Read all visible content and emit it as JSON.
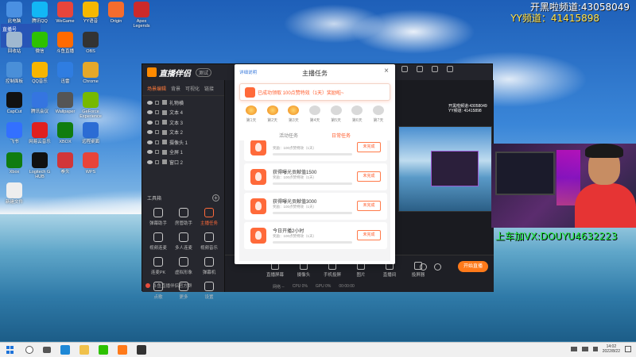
{
  "overlay": {
    "line1": "开黑啦频道:43058049",
    "line2": "YY频道：41415898",
    "line3": "上车加VX:DOUYU4632223"
  },
  "top_left_overlay": "直播号",
  "desktop_icons": [
    {
      "label": "此电脑",
      "color": "#4a90e2"
    },
    {
      "label": "腾讯QQ",
      "color": "#12b7f5"
    },
    {
      "label": "WeGame",
      "color": "#e8453c"
    },
    {
      "label": "YY语音",
      "color": "#f5b800"
    },
    {
      "label": "Origin",
      "color": "#f56c2d"
    },
    {
      "label": "Apex Legends",
      "color": "#cc2a2a"
    },
    {
      "label": "回收站",
      "color": "#9fb8d0"
    },
    {
      "label": "微信",
      "color": "#2dc100"
    },
    {
      "label": "斗鱼直播",
      "color": "#ff6a00"
    },
    {
      "label": "OBS",
      "color": "#333333"
    },
    {
      "label": "Steam",
      "color": "#1b2838"
    },
    {
      "label": "Apex Legends",
      "color": "#b02020"
    },
    {
      "label": "控制面板",
      "color": "#4a8fd8"
    },
    {
      "label": "QQ音乐",
      "color": "#f7b500"
    },
    {
      "label": "迅雷",
      "color": "#2f7de1"
    },
    {
      "label": "Chrome",
      "color": "#e5a82a"
    },
    {
      "label": "BattlEye",
      "color": "#1aa0b0"
    },
    {
      "label": "Microsoft Edge",
      "color": "#1e88d6"
    },
    {
      "label": "CapCut",
      "color": "#111111"
    },
    {
      "label": "腾讯会议",
      "color": "#3575e0"
    },
    {
      "label": "Wallpaper",
      "color": "#555555"
    },
    {
      "label": "GeForce Experience",
      "color": "#76b900"
    },
    {
      "label": "Wallpaper Engine",
      "color": "#2a6cd8"
    },
    {
      "label": "火绒",
      "color": "#ff7a00"
    },
    {
      "label": "飞书",
      "color": "#3370ff"
    },
    {
      "label": "网易云音乐",
      "color": "#e02020"
    },
    {
      "label": "XBOX",
      "color": "#107c10"
    },
    {
      "label": "远程桌面",
      "color": "#2b6cd4"
    },
    {
      "label": "Apex",
      "color": "#222222"
    },
    {
      "label": "雷神",
      "color": "#aaaaaa"
    },
    {
      "label": "Xbox",
      "color": "#107c10"
    },
    {
      "label": "Logitech G HUB",
      "color": "#111111"
    },
    {
      "label": "拳头",
      "color": "#d13639"
    },
    {
      "label": "WPS",
      "color": "#e8443a"
    },
    {
      "label": "文档",
      "color": "#f4f4f4"
    },
    {
      "label": "Golden Axe",
      "color": "#e89a20"
    },
    {
      "label": "新建文件",
      "color": "#eeeeee"
    }
  ],
  "app": {
    "name": "直播伴侣",
    "badge": "测试",
    "left_tabs": [
      "场景编辑",
      "背景",
      "可视化",
      "链接"
    ],
    "scenes": [
      "礼物横",
      "文本 4",
      "文本 3",
      "文本 2",
      "摄像头 1",
      "全屏 1",
      "窗口 2"
    ],
    "tools_title": "工具箱",
    "tools": [
      "弹幕助手",
      "房管助手",
      "主播任务",
      "视频连麦",
      "多人连麦",
      "视频音乐",
      "连麦PK",
      "虚拟形象",
      "弹幕机",
      "点歌",
      "更多",
      "设置"
    ],
    "footer": "斗鱼直播伴侣官方群",
    "bottom_tools": [
      "直播屏幕",
      "摄像头",
      "手机投屏",
      "图片",
      "直播间",
      "投屏器"
    ],
    "bottom_stats": [
      "网络 --",
      "CPU 0%",
      "GPU 0%",
      "00:00:00"
    ],
    "go_live": "开始直播",
    "preview_info": [
      "开黑啦频道:43058049",
      "YY频道: 41415898"
    ]
  },
  "dialog": {
    "link": "详细说明",
    "title": "主播任务",
    "close": "×",
    "banner": "已成功领取 100点赞特效（1天）奖励啦~",
    "days": [
      {
        "label": "第1天",
        "done": true
      },
      {
        "label": "第2天",
        "done": true
      },
      {
        "label": "第3天",
        "done": true
      },
      {
        "label": "第4天",
        "done": false
      },
      {
        "label": "第5天",
        "done": false
      },
      {
        "label": "第6天",
        "done": false
      },
      {
        "label": "第7天",
        "done": false
      }
    ],
    "tabs": [
      "活动任务",
      "日常任务"
    ],
    "active_tab": 1,
    "tasks": [
      {
        "title": "",
        "reward": "奖励：100点赞特效（1天）",
        "button": "未完成"
      },
      {
        "title": "获得曝光贡献值1500",
        "reward": "奖励：100点赞特效（1天）",
        "button": "未完成"
      },
      {
        "title": "获得曝光贡献值3000",
        "reward": "奖励：100点赞特效（1天）",
        "button": "未完成"
      },
      {
        "title": "今日开播2小时",
        "reward": "奖励：100点赞特效（1天）",
        "button": "未完成"
      }
    ]
  },
  "taskbar": {
    "time": "14:02",
    "date": "2022/8/22"
  }
}
